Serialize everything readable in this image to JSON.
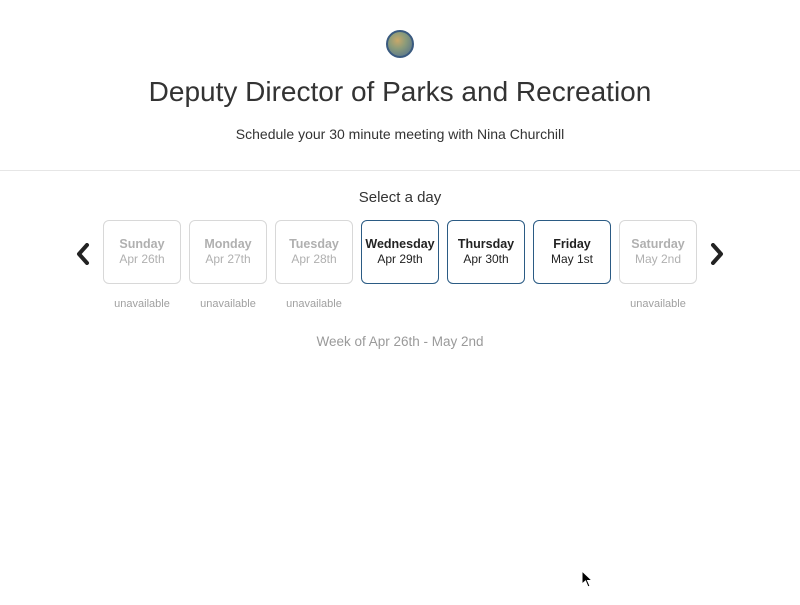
{
  "header": {
    "title": "Deputy Director of Parks and Recreation",
    "subtitle": "Schedule your 30 minute meeting with Nina Churchill"
  },
  "picker": {
    "select_label": "Select a day",
    "week_label": "Week of Apr 26th - May 2nd",
    "unavailable_text": "unavailable",
    "days": [
      {
        "name": "Sunday",
        "date": "Apr 26th",
        "available": false
      },
      {
        "name": "Monday",
        "date": "Apr 27th",
        "available": false
      },
      {
        "name": "Tuesday",
        "date": "Apr 28th",
        "available": false
      },
      {
        "name": "Wednesday",
        "date": "Apr 29th",
        "available": true
      },
      {
        "name": "Thursday",
        "date": "Apr 30th",
        "available": true
      },
      {
        "name": "Friday",
        "date": "May 1st",
        "available": true
      },
      {
        "name": "Saturday",
        "date": "May 2nd",
        "available": false
      }
    ]
  }
}
